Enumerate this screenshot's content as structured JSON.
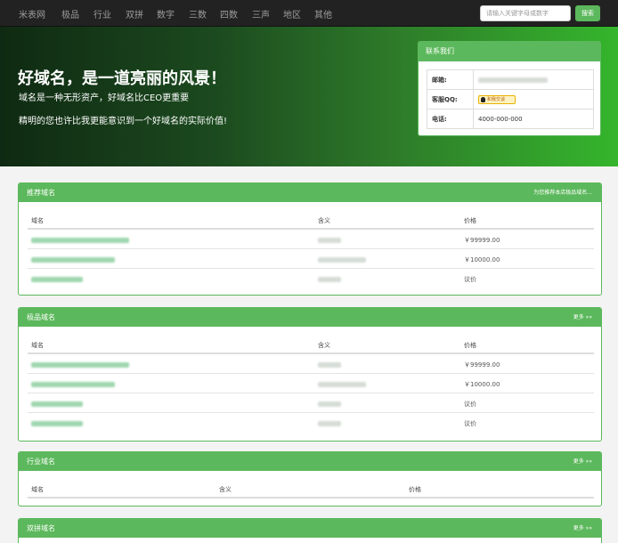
{
  "nav": {
    "brand": "米表网",
    "items": [
      "极品",
      "行业",
      "双拼",
      "数字",
      "三数",
      "四数",
      "三声",
      "地区",
      "其他"
    ],
    "search_placeholder": "请输入关键字母或数字",
    "search_button": "搜索"
  },
  "hero": {
    "title": "好域名，是一道亮丽的风景！",
    "subtitle": "域名是一种无形资产，好域名比CEO更重要",
    "tagline": "精明的您也许比我更能意识到一个好域名的实际价值!"
  },
  "contact": {
    "title": "联系我们",
    "email_label": "邮箱:",
    "qq_label": "客服QQ:",
    "qq_badge": "和我交谈",
    "phone_label": "电话:",
    "phone_value": "4000-000-000"
  },
  "table_headers": {
    "domain": "域名",
    "meaning": "含义",
    "price": "价格"
  },
  "panels": {
    "recommended": {
      "title": "推荐域名",
      "more": "为您推荐本店极品域名...",
      "rows": [
        {
          "price": "￥99999.00"
        },
        {
          "price": "￥10000.00"
        },
        {
          "price": "议价"
        }
      ]
    },
    "premium": {
      "title": "极品域名",
      "more": "更多 »»",
      "rows": [
        {
          "price": "￥99999.00"
        },
        {
          "price": "￥10000.00"
        },
        {
          "price": "议价"
        },
        {
          "price": "议价"
        }
      ]
    },
    "industry": {
      "title": "行业域名",
      "more": "更多 »»"
    },
    "pinyin": {
      "title": "双拼域名",
      "more": "更多 »»"
    }
  }
}
